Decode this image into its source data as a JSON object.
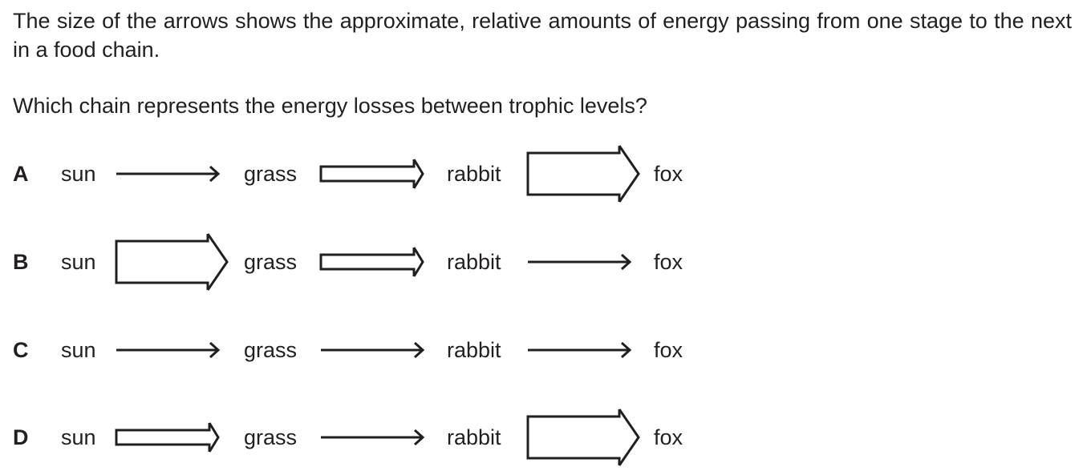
{
  "question": {
    "intro": "The size of the arrows shows the approximate, relative amounts of energy passing from one stage to the next in a food chain.",
    "prompt": "Which chain represents the energy losses between trophic levels?"
  },
  "options": [
    {
      "letter": "A",
      "stages": [
        "sun",
        "grass",
        "rabbit",
        "fox"
      ],
      "arrow_sizes": [
        "thin",
        "medium",
        "large"
      ]
    },
    {
      "letter": "B",
      "stages": [
        "sun",
        "grass",
        "rabbit",
        "fox"
      ],
      "arrow_sizes": [
        "large",
        "medium",
        "thin"
      ]
    },
    {
      "letter": "C",
      "stages": [
        "sun",
        "grass",
        "rabbit",
        "fox"
      ],
      "arrow_sizes": [
        "thin",
        "thin",
        "thin"
      ]
    },
    {
      "letter": "D",
      "stages": [
        "sun",
        "grass",
        "rabbit",
        "fox"
      ],
      "arrow_sizes": [
        "medium",
        "thin",
        "large"
      ]
    }
  ]
}
